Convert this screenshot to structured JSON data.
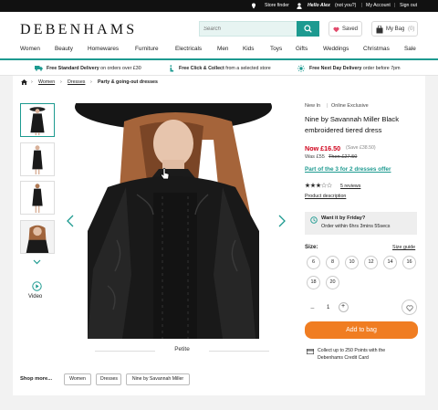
{
  "topbar": {
    "store_finder": "Store finder",
    "greeting": "Hello Alex",
    "not_you": "(not you?)",
    "separator": "|",
    "my_account": "My Account",
    "sign_out": "Sign out"
  },
  "header": {
    "logo": "DEBENHAMS",
    "search_placeholder": "Search",
    "saved_label": "Saved",
    "bag_label": "My Bag",
    "bag_count": "(0)"
  },
  "nav": [
    "Women",
    "Beauty",
    "Homewares",
    "Furniture",
    "Electricals",
    "Men",
    "Kids",
    "Toys",
    "Gifts",
    "Weddings",
    "Christmas",
    "Sale"
  ],
  "promos": [
    {
      "bold": "Free Standard Delivery",
      "rest": " on orders over £30"
    },
    {
      "bold": "Free Click & Collect",
      "rest": " from a selected store"
    },
    {
      "bold": "Free Next Day Delivery",
      "rest": " order before 7pm"
    }
  ],
  "breadcrumb": {
    "items": [
      "Women",
      "Dresses",
      "Party & going-out dresses"
    ],
    "separator": "›"
  },
  "gallery": {
    "video_label": "Video",
    "image_caption": "Petite"
  },
  "shop_more": {
    "label": "Shop more...",
    "chips": [
      "Women",
      "Dresses",
      "Nine by Savannah Miller"
    ]
  },
  "product": {
    "tag_new": "New In",
    "tag_sep": "|",
    "tag_online": "Online Exclusive",
    "title_line1": "Nine by Savannah Miller Black",
    "title_line2": "embroidered tiered dress",
    "now_price": "Now £16.50",
    "saving": "(Save £38.50)",
    "was_label": "Was £55",
    "then_label": "Then £27.50",
    "offer": "Part of the 3 for 2 dresses offer",
    "rating": 3,
    "rating_max": 5,
    "reviews": "5 reviews",
    "description_link": "Product description",
    "delivery_title": "Want it by Friday?",
    "delivery_text": "Order within 6hrs 3mins 55secs",
    "size_label": "Size:",
    "size_guide": "Size guide",
    "sizes": [
      "6",
      "8",
      "10",
      "12",
      "14",
      "16",
      "18",
      "20"
    ],
    "quantity": "1",
    "minus": "−",
    "plus": "+",
    "add_to_bag": "Add to bag",
    "points_line1": "Collect up to 250 Points with the",
    "points_line2": "Debenhams Credit Card"
  },
  "colors": {
    "teal": "#1d9a90",
    "price_red": "#d0021b",
    "add_to_bag": "#f07d22",
    "saved_heart": "#e24a6b"
  }
}
